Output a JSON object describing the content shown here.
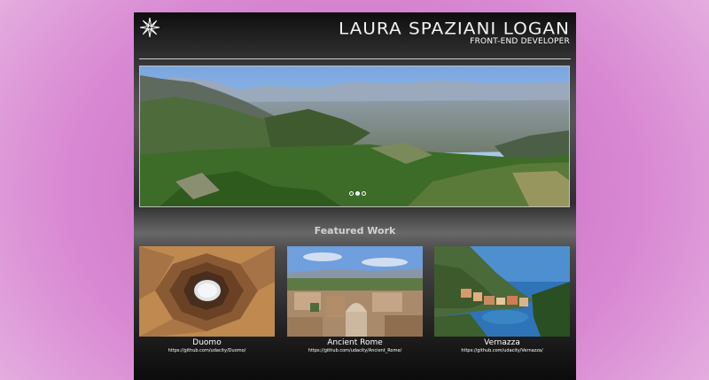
{
  "header": {
    "logo_icon": "compass-star-icon",
    "name": "LAURA SPAZIANI LOGAN",
    "role": "FRONT-END DEVELOPER"
  },
  "carousel": {
    "image": "mountain-valley-panorama",
    "slides": 3,
    "active_slide": 2
  },
  "featured": {
    "title": "Featured Work",
    "projects": [
      {
        "title": "Duomo",
        "url": "https://github.com/udacity/Duomo/",
        "image": "duomo-dome-interior"
      },
      {
        "title": "Ancient Rome",
        "url": "https://github.com/udacity/Ancient_Rome/",
        "image": "rome-cityscape"
      },
      {
        "title": "Vernazza",
        "url": "https://github.com/udacity/Vernazza/",
        "image": "vernazza-coast"
      }
    ]
  },
  "colors": {
    "background_accent": "#c45fbe",
    "text": "#ffffff"
  }
}
